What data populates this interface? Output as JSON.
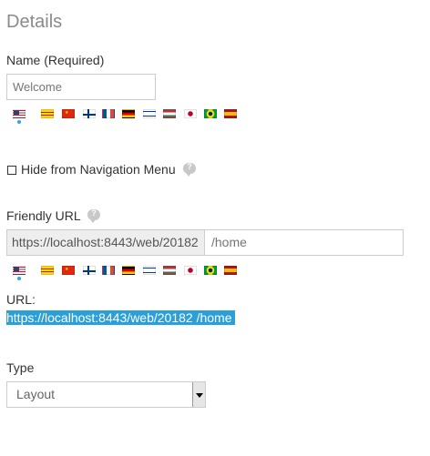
{
  "section": {
    "title": "Details"
  },
  "name_field": {
    "label": "Name (Required)",
    "value": "",
    "placeholder": "Welcome"
  },
  "locales": [
    {
      "icon": "flag-us-icon",
      "lang": "en_US",
      "selected": true
    },
    {
      "icon": "flag-catalonia-icon",
      "lang": "ca_ES",
      "selected": false
    },
    {
      "icon": "flag-china-icon",
      "lang": "zh_CN",
      "selected": false
    },
    {
      "icon": "flag-finland-icon",
      "lang": "fi_FI",
      "selected": false
    },
    {
      "icon": "flag-france-icon",
      "lang": "fr_FR",
      "selected": false
    },
    {
      "icon": "flag-germany-icon",
      "lang": "de_DE",
      "selected": false
    },
    {
      "icon": "flag-israel-icon",
      "lang": "iw_IL",
      "selected": false
    },
    {
      "icon": "flag-hungary-icon",
      "lang": "hu_HU",
      "selected": false
    },
    {
      "icon": "flag-japan-icon",
      "lang": "ja_JP",
      "selected": false
    },
    {
      "icon": "flag-brazil-icon",
      "lang": "pt_BR",
      "selected": false
    },
    {
      "icon": "flag-spain-icon",
      "lang": "es_ES",
      "selected": false
    }
  ],
  "hide_nav": {
    "label": "Hide from Navigation Menu",
    "checked": false
  },
  "friendly_url": {
    "label": "Friendly URL",
    "prefix": "https://localhost:8443/web/20182",
    "value": "",
    "placeholder": "/home"
  },
  "url": {
    "label": "URL:",
    "value": "https://localhost:8443/web/20182 /home"
  },
  "type_field": {
    "label": "Type",
    "selected": "Layout"
  },
  "colors": {
    "accent": "#2a9fd8",
    "title": "#8a8a8a",
    "border": "#cccccc"
  }
}
